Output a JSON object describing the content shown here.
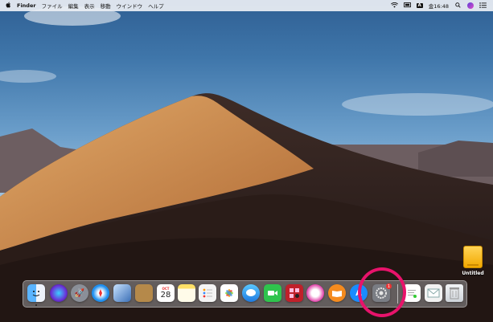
{
  "menubar": {
    "apple": "",
    "app_name": "Finder",
    "items": [
      "ファイル",
      "編集",
      "表示",
      "移動",
      "ウインドウ",
      "ヘルプ"
    ],
    "status": {
      "input_badge": "A",
      "clock": "金16:48"
    }
  },
  "desktop": {
    "drive_label": "Untitled"
  },
  "dock": {
    "calendar_day": "28",
    "calendar_month": "OCT",
    "badge_count": "1",
    "apps": [
      "Finder",
      "Siri",
      "Launchpad",
      "Safari",
      "Photos Preview",
      "Contacts",
      "Calendar",
      "Notes",
      "Reminders",
      "Photos",
      "Messages",
      "FaceTime",
      "Photo Booth",
      "iTunes",
      "iBooks",
      "App Store",
      "System Preferences",
      "Preview",
      "Mail",
      "Trash"
    ],
    "colors": {
      "finder": "#2f8fe6",
      "siri": "#6b2fd6",
      "launchpad": "#7a7f8a",
      "safari": "#1e8ff0",
      "preview": "#3b6fb6",
      "contacts": "#b5894a",
      "calendar": "#ffffff",
      "notes": "#ffe066",
      "reminders": "#f4f4f4",
      "photos": "#ffffff",
      "messages": "#2fa0ff",
      "facetime": "#2fc44d",
      "photobooth": "#c0202a",
      "itunes": "#e03aa6",
      "ibooks": "#f58b1e",
      "appstore": "#1a8cff",
      "sysprefs": "#7a7d84",
      "trash": "#d9dde2"
    }
  }
}
